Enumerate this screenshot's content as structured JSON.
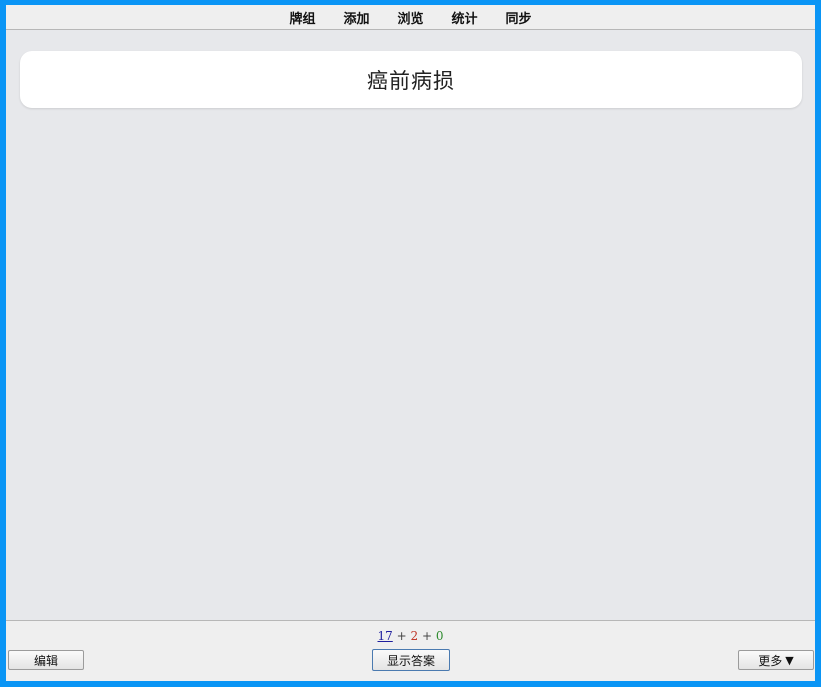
{
  "topbar": {
    "items": [
      "牌组",
      "添加",
      "浏览",
      "统计",
      "同步"
    ]
  },
  "card": {
    "front_text": "癌前病损"
  },
  "bottombar": {
    "counts": {
      "new": "17",
      "learn": "2",
      "review": "0",
      "separator": "+"
    },
    "edit_label": "编辑",
    "show_answer_label": "显示答案",
    "more_label": "更多",
    "more_icon": "▼"
  },
  "colors": {
    "frame": "#0a95f5",
    "background": "#e7e8eb",
    "new_count": "#1f1f9e",
    "learn_count": "#c0392b",
    "review_count": "#2e8b2e"
  }
}
